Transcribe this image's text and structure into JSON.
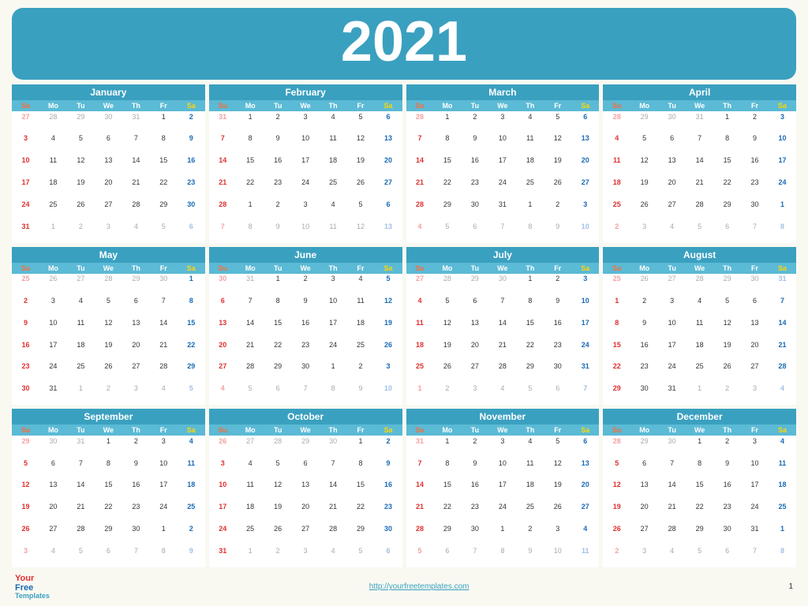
{
  "year": "2021",
  "months": [
    {
      "name": "January",
      "weeks": [
        [
          "27",
          "28",
          "29",
          "30",
          "31",
          "1",
          "2"
        ],
        [
          "3",
          "4",
          "5",
          "6",
          "7",
          "8",
          "9"
        ],
        [
          "10",
          "11",
          "12",
          "13",
          "14",
          "15",
          "16"
        ],
        [
          "17",
          "18",
          "19",
          "20",
          "21",
          "22",
          "23"
        ],
        [
          "24",
          "25",
          "26",
          "27",
          "28",
          "29",
          "30"
        ],
        [
          "31",
          "1",
          "2",
          "3",
          "4",
          "5",
          "6"
        ]
      ],
      "other": [
        [
          0,
          0,
          0,
          0,
          0
        ],
        [],
        [],
        [],
        [],
        [
          1,
          1,
          1,
          1,
          1,
          1
        ]
      ]
    },
    {
      "name": "February",
      "weeks": [
        [
          "31",
          "1",
          "2",
          "3",
          "4",
          "5",
          "6"
        ],
        [
          "7",
          "8",
          "9",
          "10",
          "11",
          "12",
          "13"
        ],
        [
          "14",
          "15",
          "16",
          "17",
          "18",
          "19",
          "20"
        ],
        [
          "21",
          "22",
          "23",
          "24",
          "25",
          "26",
          "27"
        ],
        [
          "28",
          "1",
          "2",
          "3",
          "4",
          "5",
          "6"
        ],
        [
          "7",
          "8",
          "9",
          "10",
          "11",
          "12",
          "13"
        ]
      ],
      "other": [
        [
          1
        ],
        [],
        [],
        [],
        [],
        [
          1,
          1,
          1,
          1,
          1,
          1,
          1
        ]
      ]
    },
    {
      "name": "March",
      "weeks": [
        [
          "28",
          "1",
          "2",
          "3",
          "4",
          "5",
          "6"
        ],
        [
          "7",
          "8",
          "9",
          "10",
          "11",
          "12",
          "13"
        ],
        [
          "14",
          "15",
          "16",
          "17",
          "18",
          "19",
          "20"
        ],
        [
          "21",
          "22",
          "23",
          "24",
          "25",
          "26",
          "27"
        ],
        [
          "28",
          "29",
          "30",
          "31",
          "1",
          "2",
          "3"
        ],
        [
          "4",
          "5",
          "6",
          "7",
          "8",
          "9",
          "10"
        ]
      ],
      "other": [
        [
          1
        ],
        [],
        [],
        [],
        [],
        [
          1,
          1,
          1,
          1,
          1,
          1,
          1
        ]
      ]
    },
    {
      "name": "April",
      "weeks": [
        [
          "28",
          "29",
          "30",
          "31",
          "1",
          "2",
          "3"
        ],
        [
          "4",
          "5",
          "6",
          "7",
          "8",
          "9",
          "10"
        ],
        [
          "11",
          "12",
          "13",
          "14",
          "15",
          "16",
          "17"
        ],
        [
          "18",
          "19",
          "20",
          "21",
          "22",
          "23",
          "24"
        ],
        [
          "25",
          "26",
          "27",
          "28",
          "29",
          "30",
          "1"
        ],
        [
          "2",
          "3",
          "4",
          "5",
          "6",
          "7",
          "8"
        ]
      ],
      "other": [
        [
          1,
          1,
          1,
          1
        ],
        [],
        [],
        [],
        [],
        [
          1,
          1,
          1,
          1,
          1,
          1,
          1
        ]
      ]
    },
    {
      "name": "May",
      "weeks": [
        [
          "25",
          "26",
          "27",
          "28",
          "29",
          "30",
          "1"
        ],
        [
          "2",
          "3",
          "4",
          "5",
          "6",
          "7",
          "8"
        ],
        [
          "9",
          "10",
          "11",
          "12",
          "13",
          "14",
          "15"
        ],
        [
          "16",
          "17",
          "18",
          "19",
          "20",
          "21",
          "22"
        ],
        [
          "23",
          "24",
          "25",
          "26",
          "27",
          "28",
          "29"
        ],
        [
          "30",
          "31",
          "1",
          "2",
          "3",
          "4",
          "5"
        ]
      ],
      "other": [
        [
          1,
          1,
          1,
          1,
          1,
          1
        ],
        [],
        [],
        [],
        [],
        [],
        [
          1,
          1,
          1,
          1,
          1
        ]
      ]
    },
    {
      "name": "June",
      "weeks": [
        [
          "30",
          "31",
          "1",
          "2",
          "3",
          "4",
          "5"
        ],
        [
          "6",
          "7",
          "8",
          "9",
          "10",
          "11",
          "12"
        ],
        [
          "13",
          "14",
          "15",
          "16",
          "17",
          "18",
          "19"
        ],
        [
          "20",
          "21",
          "22",
          "23",
          "24",
          "25",
          "26"
        ],
        [
          "27",
          "28",
          "29",
          "30",
          "1",
          "2",
          "3"
        ],
        [
          "4",
          "5",
          "6",
          "7",
          "8",
          "9",
          "10"
        ]
      ],
      "other": [
        [
          1,
          1
        ],
        [],
        [],
        [],
        [],
        [
          1,
          1,
          1,
          1,
          1,
          1,
          1
        ]
      ]
    },
    {
      "name": "July",
      "weeks": [
        [
          "27",
          "28",
          "29",
          "30",
          "1",
          "2",
          "3"
        ],
        [
          "4",
          "5",
          "6",
          "7",
          "8",
          "9",
          "10"
        ],
        [
          "11",
          "12",
          "13",
          "14",
          "15",
          "16",
          "17"
        ],
        [
          "18",
          "19",
          "20",
          "21",
          "22",
          "23",
          "24"
        ],
        [
          "25",
          "26",
          "27",
          "28",
          "29",
          "30",
          "31"
        ],
        [
          "1",
          "2",
          "3",
          "4",
          "5",
          "6",
          "7"
        ]
      ],
      "other": [
        [
          1,
          1,
          1,
          1
        ],
        [],
        [],
        [],
        [],
        [
          1,
          1,
          1,
          1,
          1,
          1,
          1
        ]
      ]
    },
    {
      "name": "August",
      "weeks": [
        [
          "25",
          "26",
          "27",
          "28",
          "29",
          "30",
          "31"
        ],
        [
          "1",
          "2",
          "3",
          "4",
          "5",
          "6",
          "7"
        ],
        [
          "8",
          "9",
          "10",
          "11",
          "12",
          "13",
          "14"
        ],
        [
          "15",
          "16",
          "17",
          "18",
          "19",
          "20",
          "21"
        ],
        [
          "22",
          "23",
          "24",
          "25",
          "26",
          "27",
          "28"
        ],
        [
          "29",
          "30",
          "31",
          "1",
          "2",
          "3",
          "4"
        ]
      ],
      "other": [
        [
          1,
          1,
          1,
          1,
          1,
          1,
          1
        ],
        [],
        [],
        [],
        [],
        [],
        [
          1,
          1,
          1,
          1
        ]
      ]
    },
    {
      "name": "September",
      "weeks": [
        [
          "29",
          "30",
          "31",
          "1",
          "2",
          "3",
          "4"
        ],
        [
          "5",
          "6",
          "7",
          "8",
          "9",
          "10",
          "11"
        ],
        [
          "12",
          "13",
          "14",
          "15",
          "16",
          "17",
          "18"
        ],
        [
          "19",
          "20",
          "21",
          "22",
          "23",
          "24",
          "25"
        ],
        [
          "26",
          "27",
          "28",
          "29",
          "30",
          "1",
          "2"
        ],
        [
          "3",
          "4",
          "5",
          "6",
          "7",
          "8",
          "9"
        ]
      ],
      "other": [
        [
          1,
          1,
          1
        ],
        [],
        [],
        [],
        [],
        [
          1,
          1,
          1,
          1,
          1,
          1,
          1
        ]
      ]
    },
    {
      "name": "October",
      "weeks": [
        [
          "26",
          "27",
          "28",
          "29",
          "30",
          "1",
          "2"
        ],
        [
          "3",
          "4",
          "5",
          "6",
          "7",
          "8",
          "9"
        ],
        [
          "10",
          "11",
          "12",
          "13",
          "14",
          "15",
          "16"
        ],
        [
          "17",
          "18",
          "19",
          "20",
          "21",
          "22",
          "23"
        ],
        [
          "24",
          "25",
          "26",
          "27",
          "28",
          "29",
          "30"
        ],
        [
          "31",
          "1",
          "2",
          "3",
          "4",
          "5",
          "6"
        ]
      ],
      "other": [
        [
          1,
          1,
          1,
          1,
          1
        ],
        [],
        [],
        [],
        [],
        [],
        [
          1,
          1,
          1,
          1,
          1,
          1
        ]
      ]
    },
    {
      "name": "November",
      "weeks": [
        [
          "31",
          "1",
          "2",
          "3",
          "4",
          "5",
          "6"
        ],
        [
          "7",
          "8",
          "9",
          "10",
          "11",
          "12",
          "13"
        ],
        [
          "14",
          "15",
          "16",
          "17",
          "18",
          "19",
          "20"
        ],
        [
          "21",
          "22",
          "23",
          "24",
          "25",
          "26",
          "27"
        ],
        [
          "28",
          "29",
          "30",
          "1",
          "2",
          "3",
          "4"
        ],
        [
          "5",
          "6",
          "7",
          "8",
          "9",
          "10",
          "11"
        ]
      ],
      "other": [
        [
          1
        ],
        [],
        [],
        [],
        [],
        [
          1,
          1,
          1,
          1,
          1,
          1,
          1
        ]
      ]
    },
    {
      "name": "December",
      "weeks": [
        [
          "28",
          "29",
          "30",
          "1",
          "2",
          "3",
          "4"
        ],
        [
          "5",
          "6",
          "7",
          "8",
          "9",
          "10",
          "11"
        ],
        [
          "12",
          "13",
          "14",
          "15",
          "16",
          "17",
          "18"
        ],
        [
          "19",
          "20",
          "21",
          "22",
          "23",
          "24",
          "25"
        ],
        [
          "26",
          "27",
          "28",
          "29",
          "30",
          "31",
          "1"
        ],
        [
          "2",
          "3",
          "4",
          "5",
          "6",
          "7",
          "8"
        ]
      ],
      "other": [
        [
          1,
          1,
          1
        ],
        [],
        [],
        [],
        [],
        [
          1,
          1,
          1,
          1,
          1,
          1,
          1
        ]
      ]
    }
  ],
  "day_headers": [
    "Su",
    "Mo",
    "Tu",
    "We",
    "Th",
    "Fr",
    "Sa"
  ],
  "footer": {
    "link": "http://yourfreetemplates.com",
    "page": "1",
    "logo_your": "Your",
    "logo_free": "Free",
    "logo_templates": "Templates"
  }
}
